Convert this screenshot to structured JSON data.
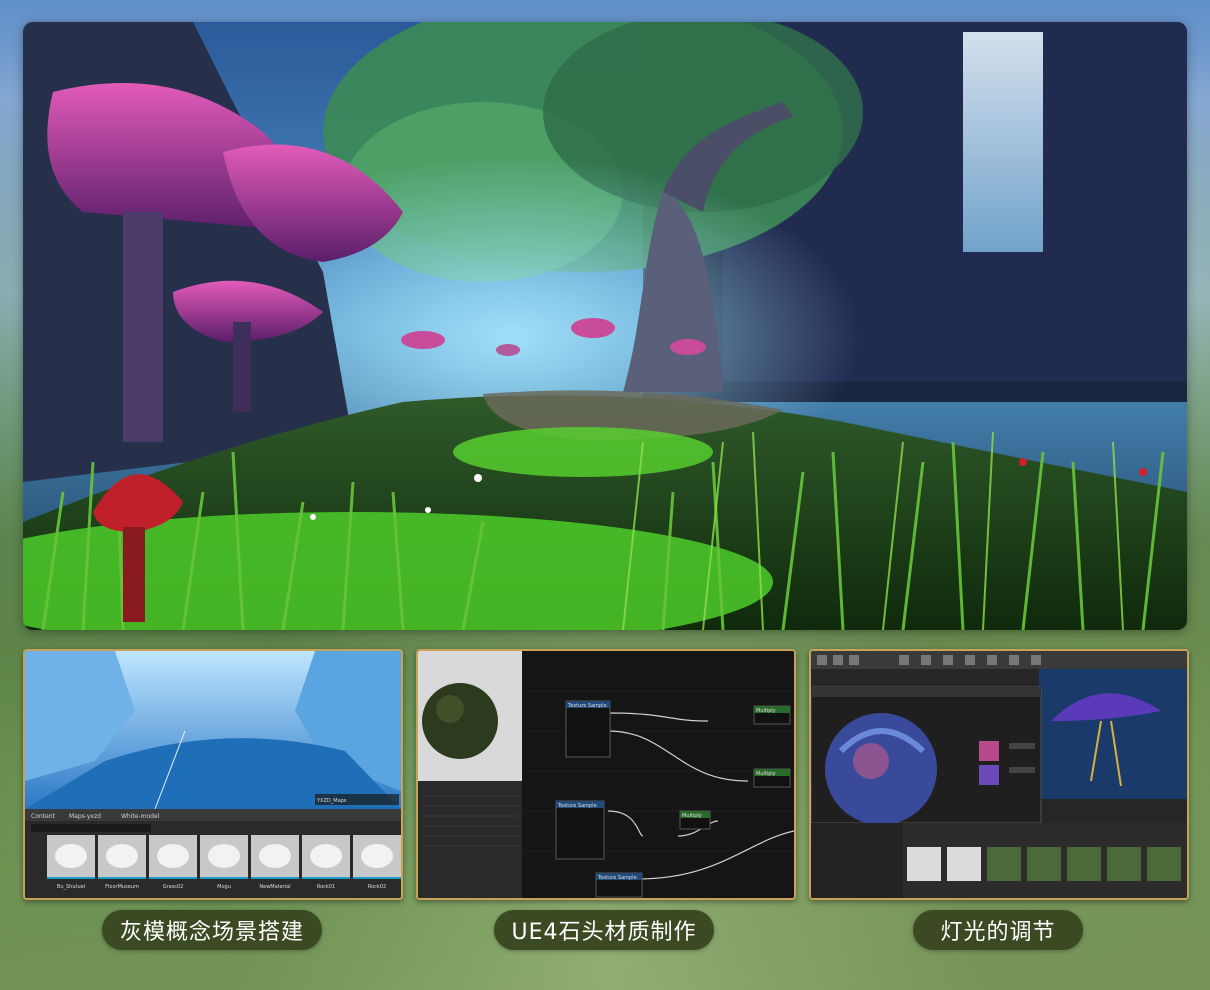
{
  "panels": [
    {
      "caption": "灰模概念场景搭建",
      "path": [
        "Content",
        "Maps-yxzd",
        "White-model"
      ],
      "assets": [
        "Bu_Shutuel",
        "FloorMuseum",
        "Grass02",
        "Mogu",
        "NewMaterial",
        "Rock01",
        "Rock02"
      ]
    },
    {
      "caption": "UE4石头材质制作",
      "nodes": [
        "Texture Sample",
        "Texture Sample",
        "Texture Sample",
        "Multiply",
        "Multiply",
        "Multiply"
      ]
    },
    {
      "caption": "灯光的调节"
    }
  ],
  "colors": {
    "caption_bg": "#3b4a22",
    "caption_text": "#ffffff",
    "thumb_border": "#c9a25a"
  }
}
